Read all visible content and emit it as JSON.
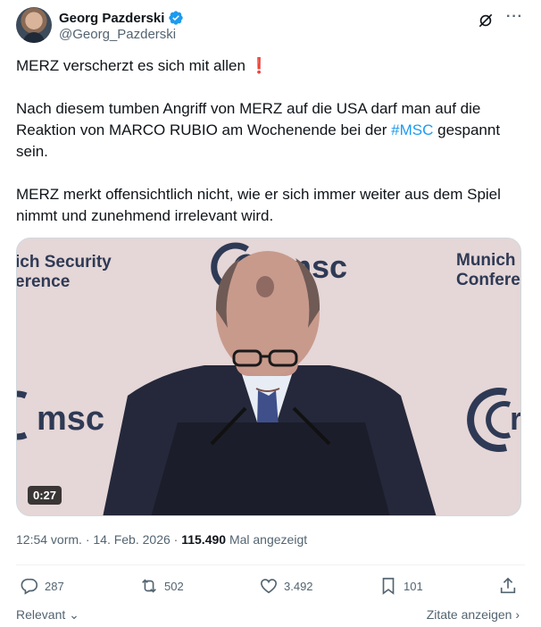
{
  "author": {
    "name": "Georg Pazderski",
    "handle": "@Georg_Pazderski"
  },
  "icons": {
    "verified": "verified-badge-icon",
    "grok": "grok-icon",
    "more": "more-icon"
  },
  "post": {
    "line1": "MERZ verscherzt es sich mit allen",
    "line1_emoji": "❗",
    "para2_before": "Nach diesem tumben Angriff von MERZ auf die USA darf man auf die Reaktion von MARCO RUBIO am Wochenende bei der ",
    "para2_hashtag": "#MSC",
    "para2_after": " gespannt sein.",
    "para3": "MERZ merkt offensichtlich nicht, wie er sich immer weiter aus dem Spiel nimmt und zunehmend irrelevant wird."
  },
  "video": {
    "duration": "0:27",
    "backdrop_left": "ich Security",
    "backdrop_left2": "erence",
    "backdrop_right": "Munich",
    "backdrop_right2": "Conferen",
    "logo_top": "msc",
    "logo_left": "msc",
    "logo_right_letter": "r"
  },
  "meta": {
    "time_date": "12:54 vorm. · 14. Feb. 2026 · ",
    "views": "115.490",
    "views_label": " Mal angezeigt"
  },
  "actions": {
    "replies": "287",
    "reposts": "502",
    "likes": "3.492",
    "bookmarks": "101"
  },
  "footer": {
    "relevant": "Relevant",
    "quotes": "Zitate anzeigen"
  },
  "colors": {
    "accent": "#1d9bf0",
    "text": "#0f1419",
    "muted": "#536471",
    "warn": "#e0245e"
  }
}
